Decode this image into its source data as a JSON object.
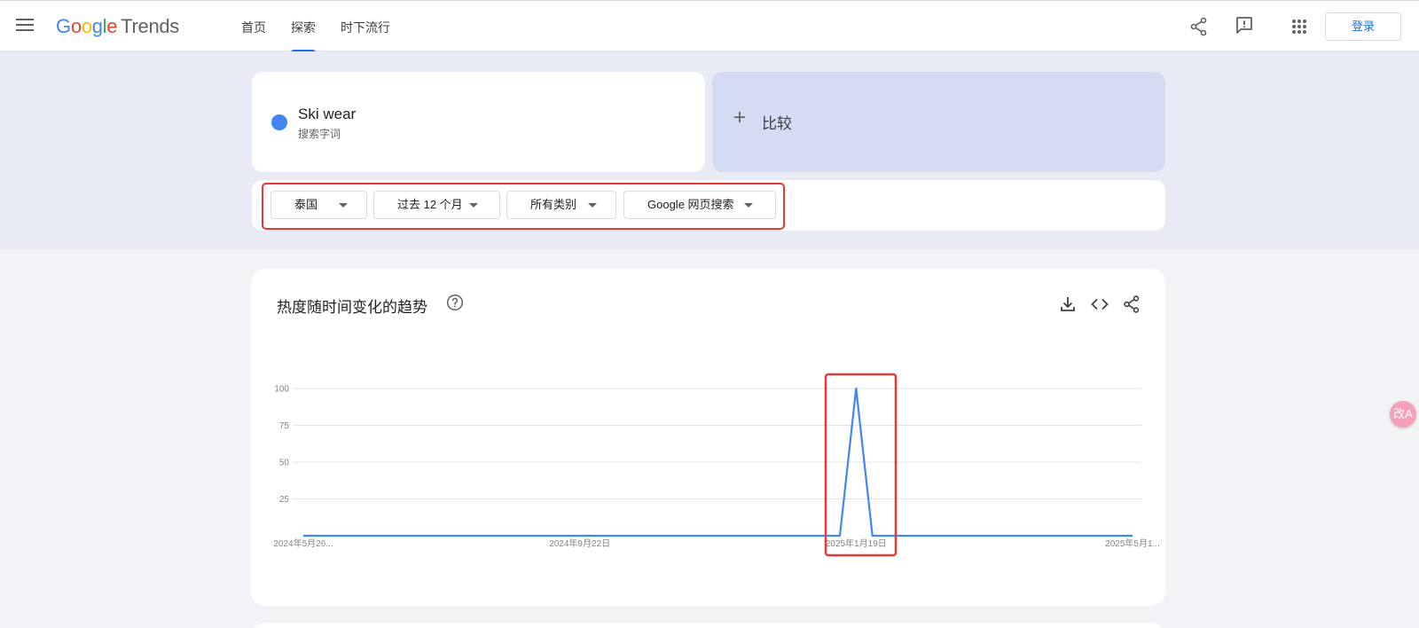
{
  "header": {
    "logo_google": "Google",
    "logo_trends": "Trends",
    "nav": [
      {
        "label": "首页",
        "active": false
      },
      {
        "label": "探索",
        "active": true
      },
      {
        "label": "时下流行",
        "active": false
      }
    ],
    "icons": [
      "menu-icon",
      "share-icon",
      "feedback-icon",
      "apps-icon"
    ],
    "signin_label": "登录"
  },
  "search": {
    "term": "Ski wear",
    "term_type": "搜索字词",
    "term_color": "#4285f4",
    "compare_label": "比较"
  },
  "filters": {
    "region": "泰国",
    "time": "过去 12 个月",
    "category": "所有类别",
    "source": "Google 网页搜索"
  },
  "chart_card": {
    "title": "热度随时间变化的趋势",
    "icons": [
      "help-icon",
      "download-icon",
      "embed-icon",
      "share-icon"
    ]
  },
  "chart_data": {
    "type": "line",
    "series": [
      {
        "color": "#4285f4",
        "values": [
          0,
          0,
          0,
          0,
          0,
          0,
          0,
          0,
          0,
          0,
          0,
          0,
          0,
          0,
          0,
          0,
          0,
          0,
          0,
          0,
          0,
          0,
          0,
          0,
          0,
          0,
          0,
          0,
          0,
          0,
          0,
          0,
          0,
          0,
          100,
          0,
          0,
          0,
          0,
          0,
          0,
          0,
          0,
          0,
          0,
          0,
          0,
          0,
          0,
          0,
          0,
          0
        ]
      }
    ],
    "x_tick_labels": [
      "2024年5月26...",
      "2024年9月22日",
      "2025年1月19日",
      "2025年5月1..."
    ],
    "x_tick_indices": [
      0,
      17,
      34,
      51
    ],
    "y_ticks": [
      25,
      50,
      75,
      100
    ],
    "ylim": [
      0,
      100
    ],
    "grid": true
  },
  "side_badge": "改A"
}
